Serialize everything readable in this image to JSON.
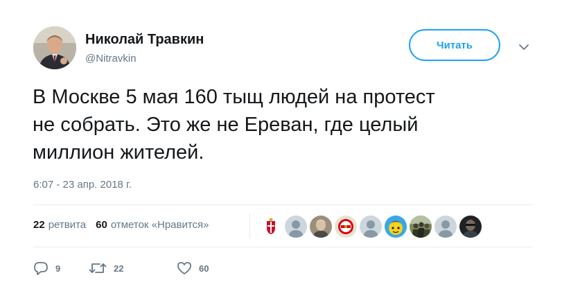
{
  "user": {
    "name": "Николай Травкин",
    "handle": "@Nitravkin",
    "avatar_icon": "user-photo"
  },
  "follow_button": {
    "label": "Читать"
  },
  "more_menu_icon": "chevron-down-icon",
  "tweet": {
    "text_lines": [
      "В Москве 5 мая 160 тыщ людей на протест",
      "не собрать. Это же не Ереван, где целый",
      "миллион жителей."
    ],
    "timestamp": "6:07 - 23 апр. 2018 г."
  },
  "stats": {
    "retweets_count": "22",
    "retweets_label": "ретвита",
    "likes_count": "60",
    "likes_label": "отметок «Нравится»"
  },
  "likers": [
    {
      "type": "emblem",
      "icon": "emblem-avatar"
    },
    {
      "type": "default",
      "icon": "default-avatar"
    },
    {
      "type": "photo",
      "icon": "person-photo-avatar"
    },
    {
      "type": "logo",
      "icon": "club-logo-avatar"
    },
    {
      "type": "default",
      "icon": "default-avatar"
    },
    {
      "type": "cartoon",
      "icon": "cartoon-avatar"
    },
    {
      "type": "photo",
      "icon": "group-photo-avatar"
    },
    {
      "type": "default",
      "icon": "default-avatar"
    },
    {
      "type": "photo",
      "icon": "dark-photo-avatar"
    }
  ],
  "actions": {
    "reply_count": "9",
    "retweet_count": "22",
    "like_count": "60"
  },
  "colors": {
    "accent": "#1da1f2",
    "secondary_text": "#657786",
    "primary_text": "#14171a",
    "divider": "#e6ecf0"
  }
}
